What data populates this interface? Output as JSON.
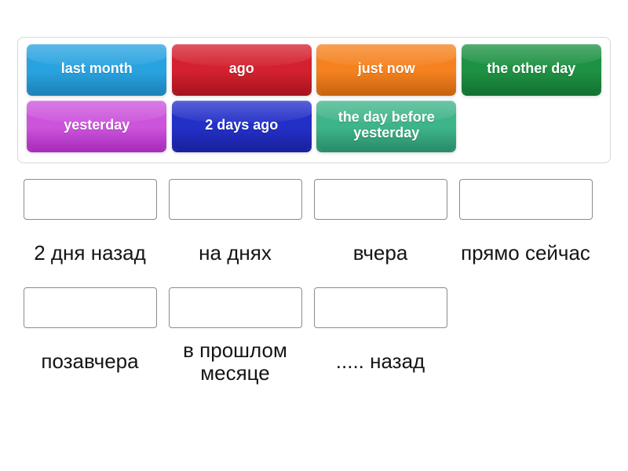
{
  "activity": {
    "type": "match-up-drag-and-drop",
    "wordbank": {
      "tiles": [
        {
          "label": "last month",
          "color": "#29A3E0",
          "color_dark": "#1D84BA"
        },
        {
          "label": "ago",
          "color": "#D4212F",
          "color_dark": "#A7141F"
        },
        {
          "label": "just now",
          "color": "#F5821F",
          "color_dark": "#C96510"
        },
        {
          "label": "the other day",
          "color": "#1E9244",
          "color_dark": "#147232"
        },
        {
          "label": "yesterday",
          "color": "#CC54DB",
          "color_dark": "#A82EBB"
        },
        {
          "label": "2 days ago",
          "color": "#2330C8",
          "color_dark": "#1A219E"
        },
        {
          "label": "the day before yesterday",
          "color": "#3EB489",
          "color_dark": "#2A8E6B"
        }
      ]
    },
    "dropzones": {
      "row1": [
        {
          "placeholder": "",
          "label": "2 дня назад"
        },
        {
          "placeholder": "",
          "label": "на днях"
        },
        {
          "placeholder": "",
          "label": "вчера"
        },
        {
          "placeholder": "",
          "label": "прямо сейчас"
        }
      ],
      "row2": [
        {
          "placeholder": "",
          "label": "позавчера"
        },
        {
          "placeholder": "",
          "label": "в прошлом месяце"
        },
        {
          "placeholder": "",
          "label": "..... назад"
        }
      ]
    },
    "colors": {
      "page_background": "#FFFFFF",
      "wordbank_border": "#D8D8D8",
      "dropbox_border": "#8C8C8C",
      "label_text": "#151515",
      "tile_text": "#FFFFFF"
    }
  }
}
